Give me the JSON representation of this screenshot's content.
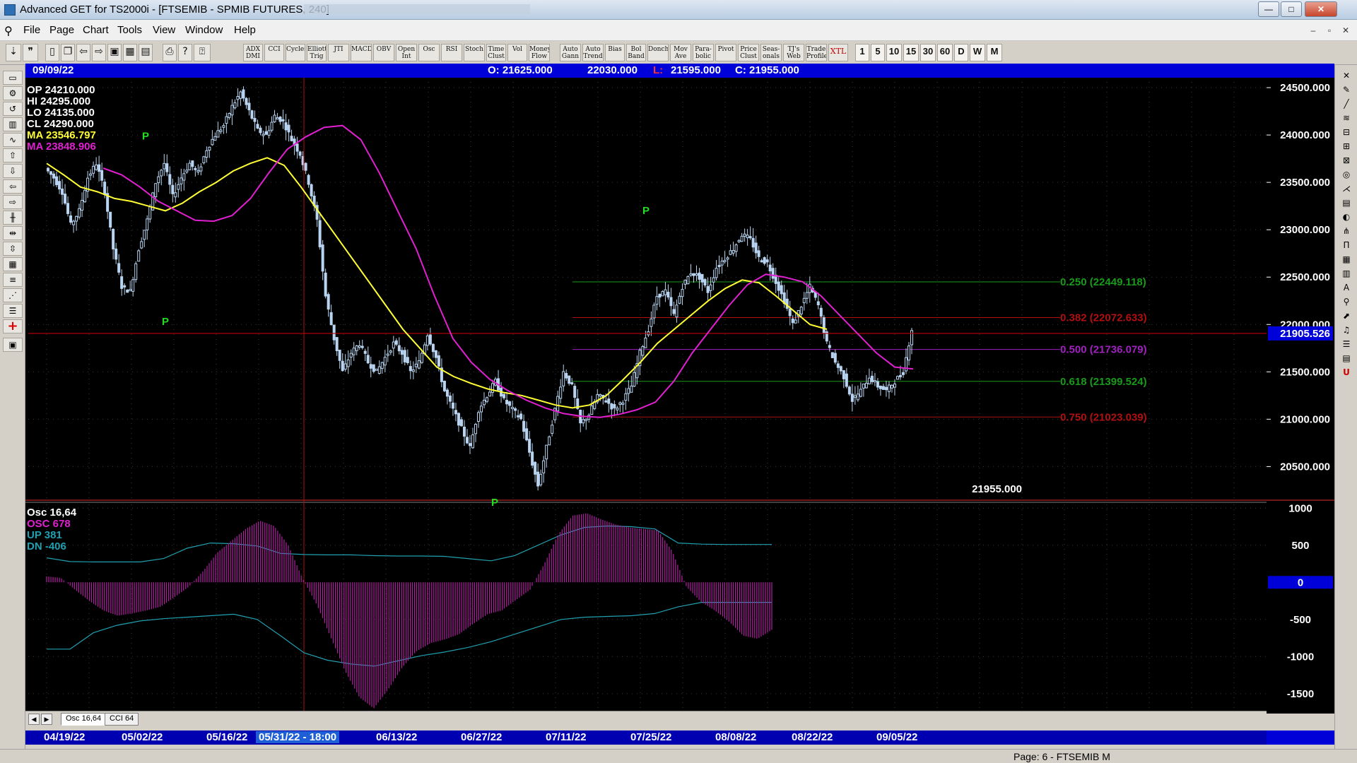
{
  "window": {
    "title": "Advanced GET for TS2000i - [FTSEMIB - SPMIB FUTURES, 240]",
    "min": "—",
    "max": "□",
    "close": "✕"
  },
  "menu": [
    {
      "label": "File"
    },
    {
      "label": "Page"
    },
    {
      "label": "Chart"
    },
    {
      "label": "Tools"
    },
    {
      "label": "View"
    },
    {
      "label": "Window"
    },
    {
      "label": "Help"
    }
  ],
  "mdi_controls": [
    "–",
    "▫",
    "✕"
  ],
  "toolbar": {
    "studies": [
      "ADX DMI",
      "CCI",
      "Cycles",
      "Elliott Trig",
      "JTI",
      "MACD",
      "OBV",
      "Open Int",
      "Osc",
      "RSI",
      "Stoch",
      "Time Clust",
      "Vol",
      "Money Flow",
      "Auto Gann",
      "Auto Trend",
      "Bias",
      "Bol Band",
      "Donch",
      "Mov Ave",
      "Para-bolic",
      "Pivot",
      "Price Clust",
      "Seas-onals",
      "TJ's Web",
      "Trade Profile",
      "XTL"
    ],
    "timeframes": [
      "1",
      "5",
      "10",
      "15",
      "30",
      "60",
      "D",
      "W",
      "M"
    ]
  },
  "header": {
    "date": "09/09/22",
    "open": "O: 21625.000",
    "high": "22030.000",
    "low_label": "L:",
    "low": "21595.000",
    "close": "C: 21955.000"
  },
  "legend": {
    "op": "OP  24210.000",
    "hi": "HI   24295.000",
    "lo": "LO  24135.000",
    "cl": "CL  24290.000",
    "ma1": "MA  23546.797",
    "ma2": "MA  23848.906",
    "last_close": "21955.000"
  },
  "osc_legend": {
    "title": "Osc 16,64",
    "osc": "OSC 678",
    "up": "UP   381",
    "dn": "DN   -406"
  },
  "price_axis": {
    "labels": [
      "24500.000",
      "24000.000",
      "23500.000",
      "23000.000",
      "22500.000",
      "22000.000",
      "21500.000",
      "21000.000",
      "20500.000"
    ],
    "current": "21905.526"
  },
  "osc_axis": {
    "labels": [
      "1000",
      "500",
      "0",
      "-500",
      "-1000",
      "-1500"
    ]
  },
  "fib_levels": [
    {
      "label": "0.250 (22449.118)",
      "value": 22449.118,
      "color": "#1a9a1a"
    },
    {
      "label": "0.382 (22072.633)",
      "value": 22072.633,
      "color": "#b01010"
    },
    {
      "label": "0.500 (21736.079)",
      "value": 21736.079,
      "color": "#a020c0"
    },
    {
      "label": "0.618 (21399.524)",
      "value": 21399.524,
      "color": "#1a9a1a"
    },
    {
      "label": "0.750 (21023.039)",
      "value": 21023.039,
      "color": "#b01010"
    }
  ],
  "pivot_label": "P",
  "tabs": [
    "Osc 16,64",
    "CCI 64"
  ],
  "date_axis": [
    "04/19/22",
    "05/02/22",
    "05/16/22",
    "05/31/22 - 18:00",
    "06/13/22",
    "06/27/22",
    "07/11/22",
    "07/25/22",
    "08/08/22",
    "08/22/22",
    "09/05/22"
  ],
  "status": "Page: 6 - FTSEMIB M",
  "colors": {
    "background": "#000000",
    "candles": "#b8d4f0",
    "ma_fast": "#ffff33",
    "ma_slow": "#e020d0",
    "osc": "#b020a0",
    "bands": "#20a0b0",
    "current_line": "#c00000"
  },
  "chart_data": {
    "type": "candlestick",
    "price_range": [
      20160,
      24560
    ],
    "osc_range": [
      -1750,
      1050
    ],
    "pivots": [
      {
        "date": "05/02/22",
        "type": "high",
        "price": 23790
      },
      {
        "date": "05/04/22",
        "type": "low",
        "price": 22160
      },
      {
        "date": "07/11/22",
        "type": "low",
        "price": 20250
      },
      {
        "date": "08/09/22",
        "type": "high",
        "price": 23000
      }
    ],
    "price_path": [
      23650,
      23550,
      23400,
      23050,
      23200,
      23550,
      23700,
      23400,
      22800,
      22400,
      22350,
      22800,
      23100,
      23500,
      23700,
      23350,
      23550,
      23700,
      23600,
      23850,
      24000,
      24100,
      24300,
      24450,
      24250,
      24050,
      24000,
      24200,
      24150,
      23950,
      23800,
      23500,
      23100,
      22300,
      21850,
      21500,
      21700,
      21800,
      21600,
      21500,
      21650,
      21800,
      21700,
      21500,
      21600,
      21900,
      21650,
      21300,
      21100,
      20900,
      20700,
      21100,
      21250,
      21400,
      21200,
      21100,
      21000,
      20650,
      20300,
      20700,
      21100,
      21500,
      21350,
      20950,
      21050,
      21250,
      21200,
      21100,
      21200,
      21350,
      21700,
      21950,
      22300,
      22350,
      22100,
      22400,
      22550,
      22500,
      22350,
      22600,
      22700,
      22800,
      22950,
      22900,
      22700,
      22650,
      22450,
      22250,
      22000,
      22200,
      22400,
      22200,
      21800,
      21600,
      21450,
      21200,
      21300,
      21450,
      21350,
      21300,
      21400,
      21500,
      21950
    ],
    "ma_fast": [
      23700,
      23580,
      23450,
      23400,
      23330,
      23300,
      23250,
      23200,
      23280,
      23400,
      23500,
      23620,
      23700,
      23760,
      23680,
      23450,
      23200,
      22950,
      22700,
      22450,
      22200,
      21950,
      21750,
      21550,
      21450,
      21380,
      21320,
      21280,
      21250,
      21200,
      21150,
      21120,
      21150,
      21250,
      21420,
      21600,
      21800,
      21950,
      22100,
      22250,
      22380,
      22470,
      22440,
      22300,
      22150,
      22000,
      21950
    ],
    "ma_slow": [
      23650,
      23580,
      23450,
      23300,
      23200,
      23100,
      23090,
      23150,
      23330,
      23600,
      23850,
      23980,
      24080,
      24100,
      23950,
      23600,
      23200,
      22800,
      22300,
      21850,
      21600,
      21420,
      21300,
      21200,
      21120,
      21060,
      21030,
      21020,
      21050,
      21100,
      21180,
      21400,
      21700,
      21950,
      22200,
      22420,
      22530,
      22500,
      22450,
      22300,
      22100,
      21900,
      21700,
      21550,
      21530
    ],
    "osc_values": [
      80,
      60,
      -100,
      -250,
      -380,
      -450,
      -420,
      -380,
      -330,
      -200,
      -60,
      150,
      400,
      560,
      720,
      830,
      760,
      500,
      50,
      -300,
      -750,
      -1200,
      -1550,
      -1700,
      -1450,
      -1150,
      -930,
      -820,
      -770,
      -700,
      -560,
      -430,
      -380,
      -240,
      -100,
      250,
      650,
      900,
      930,
      850,
      780,
      740,
      720,
      700,
      420,
      -60,
      -260,
      -380,
      -530,
      -720,
      -760,
      -640
    ],
    "osc_upper_band": [
      330,
      280,
      275,
      275,
      275,
      320,
      460,
      530,
      520,
      490,
      390,
      375,
      370,
      370,
      360,
      355,
      355,
      350,
      320,
      290,
      360,
      500,
      640,
      740,
      760,
      750,
      720,
      530,
      515,
      510,
      510,
      510
    ],
    "osc_lower_band": [
      -900,
      -900,
      -680,
      -580,
      -520,
      -490,
      -470,
      -450,
      -430,
      -500,
      -720,
      -950,
      -1050,
      -1100,
      -1130,
      -1060,
      -990,
      -940,
      -880,
      -800,
      -700,
      -600,
      -500,
      -470,
      -460,
      -450,
      -420,
      -330,
      -270,
      -270,
      -270,
      -270
    ]
  }
}
